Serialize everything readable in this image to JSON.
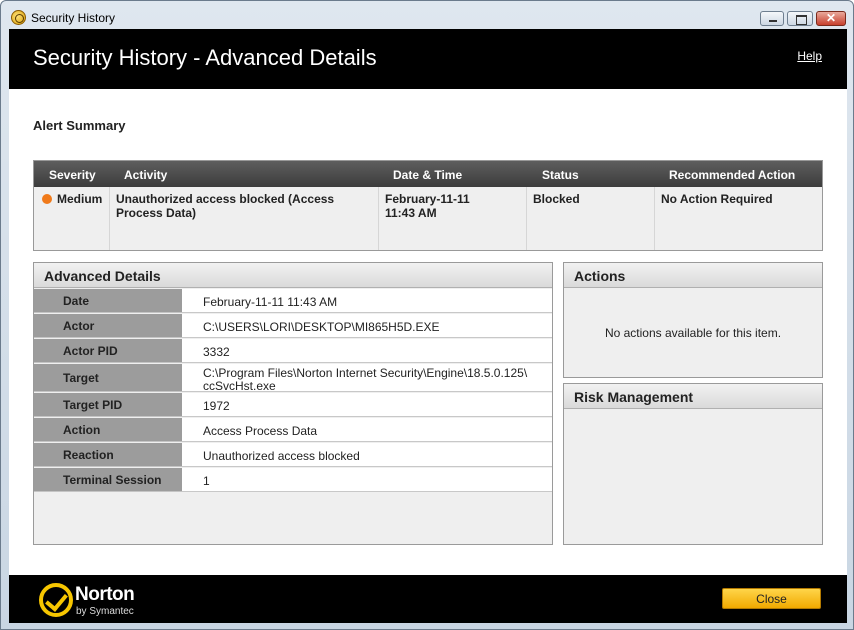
{
  "window": {
    "title": "Security History"
  },
  "header": {
    "title": "Security History - Advanced Details",
    "help_link": "Help"
  },
  "alert_summary": {
    "heading": "Alert Summary",
    "columns": [
      "Severity",
      "Activity",
      "Date & Time",
      "Status",
      "Recommended Action"
    ],
    "row": {
      "severity": "Medium",
      "severity_color": "#f07a1a",
      "activity_line1": "Unauthorized access blocked (Access",
      "activity_line2": "Process Data)",
      "datetime_line1": "February-11-11",
      "datetime_line2": "11:43 AM",
      "status": "Blocked",
      "recommended_action": "No Action Required"
    }
  },
  "advanced_details": {
    "heading": "Advanced Details",
    "rows": [
      {
        "label": "Date",
        "value": "February-11-11 11:43 AM"
      },
      {
        "label": "Actor",
        "value": "C:\\USERS\\LORI\\DESKTOP\\MI865H5D.EXE"
      },
      {
        "label": "Actor PID",
        "value": "3332"
      },
      {
        "label": "Target",
        "value": "C:\\Program Files\\Norton Internet Security\\Engine\\18.5.0.125\\",
        "value2": "ccSvcHst.exe"
      },
      {
        "label": "Target PID",
        "value": "1972"
      },
      {
        "label": "Action",
        "value": "Access Process Data"
      },
      {
        "label": "Reaction",
        "value": "Unauthorized access blocked"
      },
      {
        "label": "Terminal Session",
        "value": "1"
      }
    ]
  },
  "actions_panel": {
    "heading": "Actions",
    "empty_text": "No actions available for this item."
  },
  "risk_panel": {
    "heading": "Risk Management"
  },
  "footer": {
    "logo_name": "Norton",
    "logo_sub": "by Symantec",
    "close_label": "Close",
    "accent": "#f7c600"
  }
}
